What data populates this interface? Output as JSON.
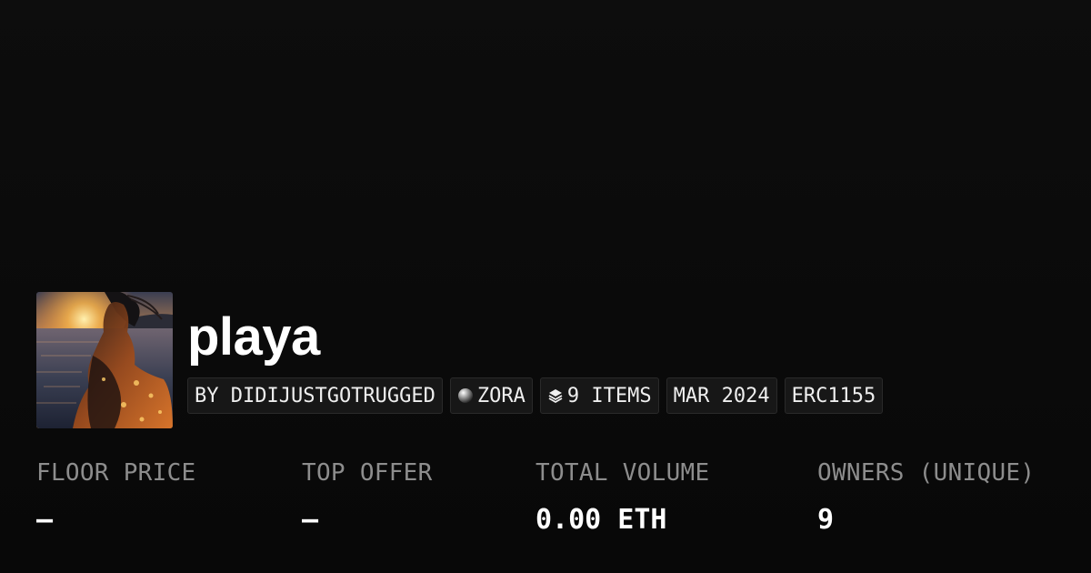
{
  "collection": {
    "title": "playa",
    "thumbnail_alt": "woman silhouette on beach at sunset"
  },
  "tags": [
    {
      "label": "BY DIDIJUSTGOTRUGGED",
      "icon": ""
    },
    {
      "label": "ZORA",
      "icon": "zora-sphere-icon"
    },
    {
      "label": "9 ITEMS",
      "icon": "layers-icon"
    },
    {
      "label": "MAR 2024",
      "icon": ""
    },
    {
      "label": "ERC1155",
      "icon": ""
    }
  ],
  "stats": [
    {
      "label": "FLOOR PRICE",
      "value": "–"
    },
    {
      "label": "TOP OFFER",
      "value": "–"
    },
    {
      "label": "TOTAL VOLUME",
      "value": "0.00 ETH"
    },
    {
      "label": "OWNERS (UNIQUE)",
      "value": "9"
    }
  ],
  "colors": {
    "background": "#0b0b0b",
    "tag_background": "#171717",
    "label_gray": "#8d8d8d",
    "text_white": "#ffffff"
  }
}
